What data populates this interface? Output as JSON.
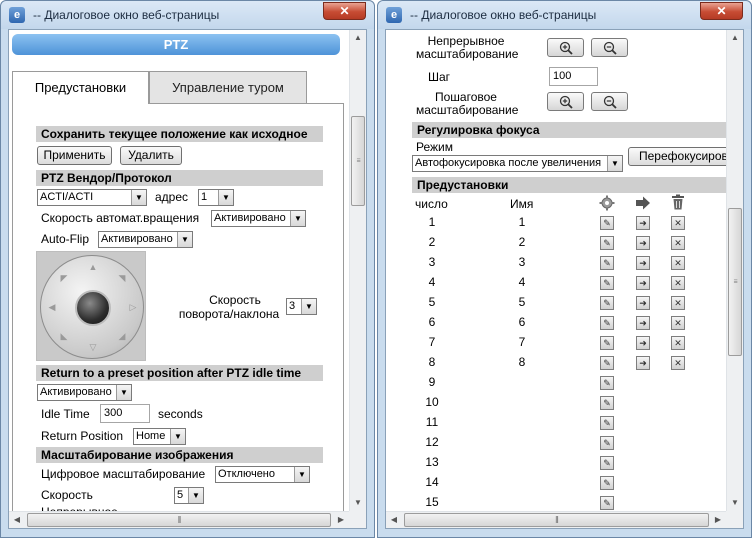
{
  "window_title": "-- Диалоговое окно веб-страницы",
  "left": {
    "banner": "PTZ",
    "tabs": [
      "Предустановки",
      "Управление туром"
    ],
    "save_section": "Сохранить текущее положение как исходное",
    "apply_button": "Применить",
    "delete_button": "Удалить",
    "vendor_section": "PTZ Вендор/Протокол",
    "vendor_value": "ACTI/ACTI",
    "address_label": "адрес",
    "address_value": "1",
    "auto_rotate_label": "Скорость автомат.вращения",
    "auto_rotate_value": "Активировано",
    "autoflip_label": "Auto-Flip",
    "autoflip_value": "Активировано",
    "pan_tilt_speed_label_1": "Скорость",
    "pan_tilt_speed_label_2": "поворота/наклона",
    "pan_tilt_speed_value": "3",
    "return_section": "Return to a preset position after PTZ idle time",
    "return_value": "Активировано",
    "idle_time_label": "Idle Time",
    "idle_time_value": "300",
    "idle_time_unit": "seconds",
    "return_position_label": "Return Position",
    "return_position_value": "Home",
    "scale_section": "Масштабирование изображения",
    "digital_zoom_label": "Цифровое масштабирование",
    "digital_zoom_value": "Отключено",
    "speed_label": "Скорость",
    "speed_value": "5",
    "continuous_partial": "Непрерывное"
  },
  "right": {
    "continuous_label_1": "Непрерывное",
    "continuous_label_2": "масштабирование",
    "step_label": "Шаг",
    "step_value": "100",
    "stepwise_label_1": "Пошаговое",
    "stepwise_label_2": "масштабирование",
    "focus_section": "Регулировка фокуса",
    "mode_label": "Режим",
    "mode_value": "Автофокусировка после увеличения",
    "refocus_button": "Перефокусировка",
    "presets_section": "Предустановки",
    "col_number": "число",
    "col_name": "Имя",
    "presets": [
      {
        "n": "1",
        "name": "1"
      },
      {
        "n": "2",
        "name": "2"
      },
      {
        "n": "3",
        "name": "3"
      },
      {
        "n": "4",
        "name": "4"
      },
      {
        "n": "5",
        "name": "5"
      },
      {
        "n": "6",
        "name": "6"
      },
      {
        "n": "7",
        "name": "7"
      },
      {
        "n": "8",
        "name": "8"
      },
      {
        "n": "9",
        "name": ""
      },
      {
        "n": "10",
        "name": ""
      },
      {
        "n": "11",
        "name": ""
      },
      {
        "n": "12",
        "name": ""
      },
      {
        "n": "13",
        "name": ""
      },
      {
        "n": "14",
        "name": ""
      },
      {
        "n": "15",
        "name": ""
      }
    ]
  }
}
